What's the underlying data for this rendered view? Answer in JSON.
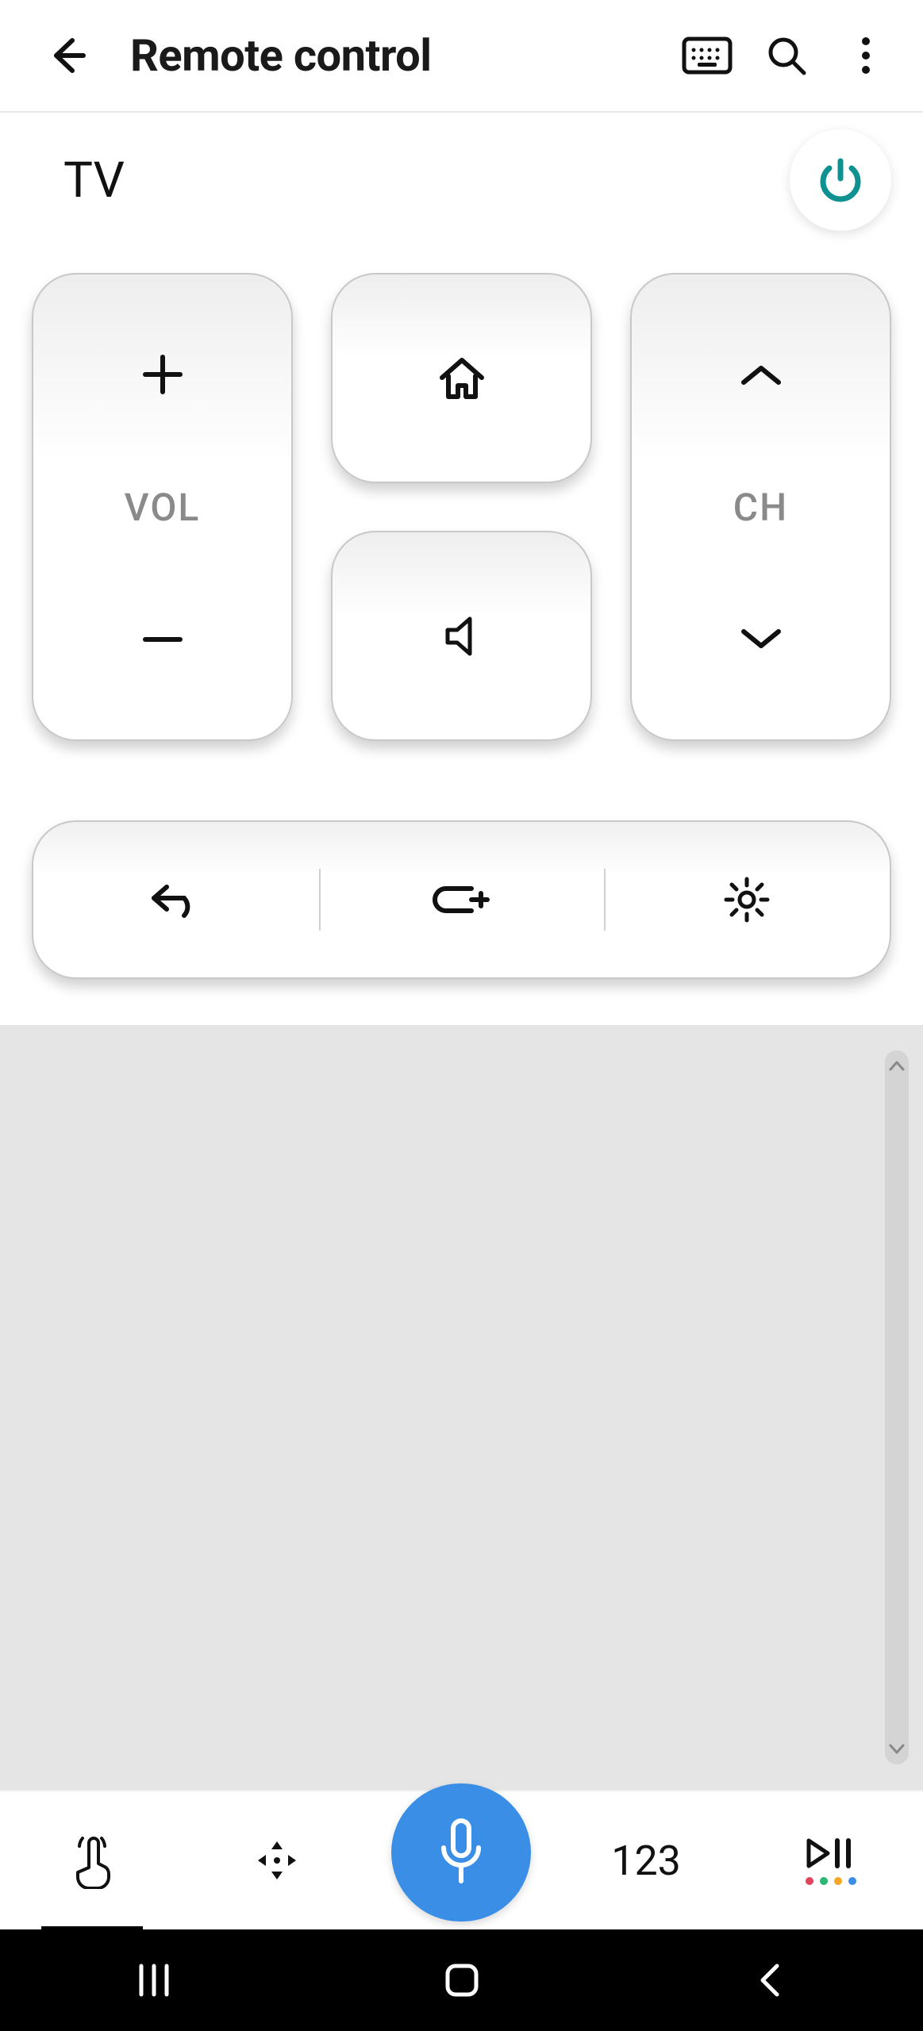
{
  "appbar": {
    "title": "Remote control"
  },
  "device": {
    "name": "TV"
  },
  "remote": {
    "vol_label": "VOL",
    "ch_label": "CH"
  },
  "bottom": {
    "numbers_label": "123"
  },
  "colors": {
    "accent": "#0f9191",
    "mic": "#3a8ee6",
    "dot1": "#e2445c",
    "dot2": "#2bb673",
    "dot3": "#f5a623",
    "dot4": "#3a8ee6"
  }
}
